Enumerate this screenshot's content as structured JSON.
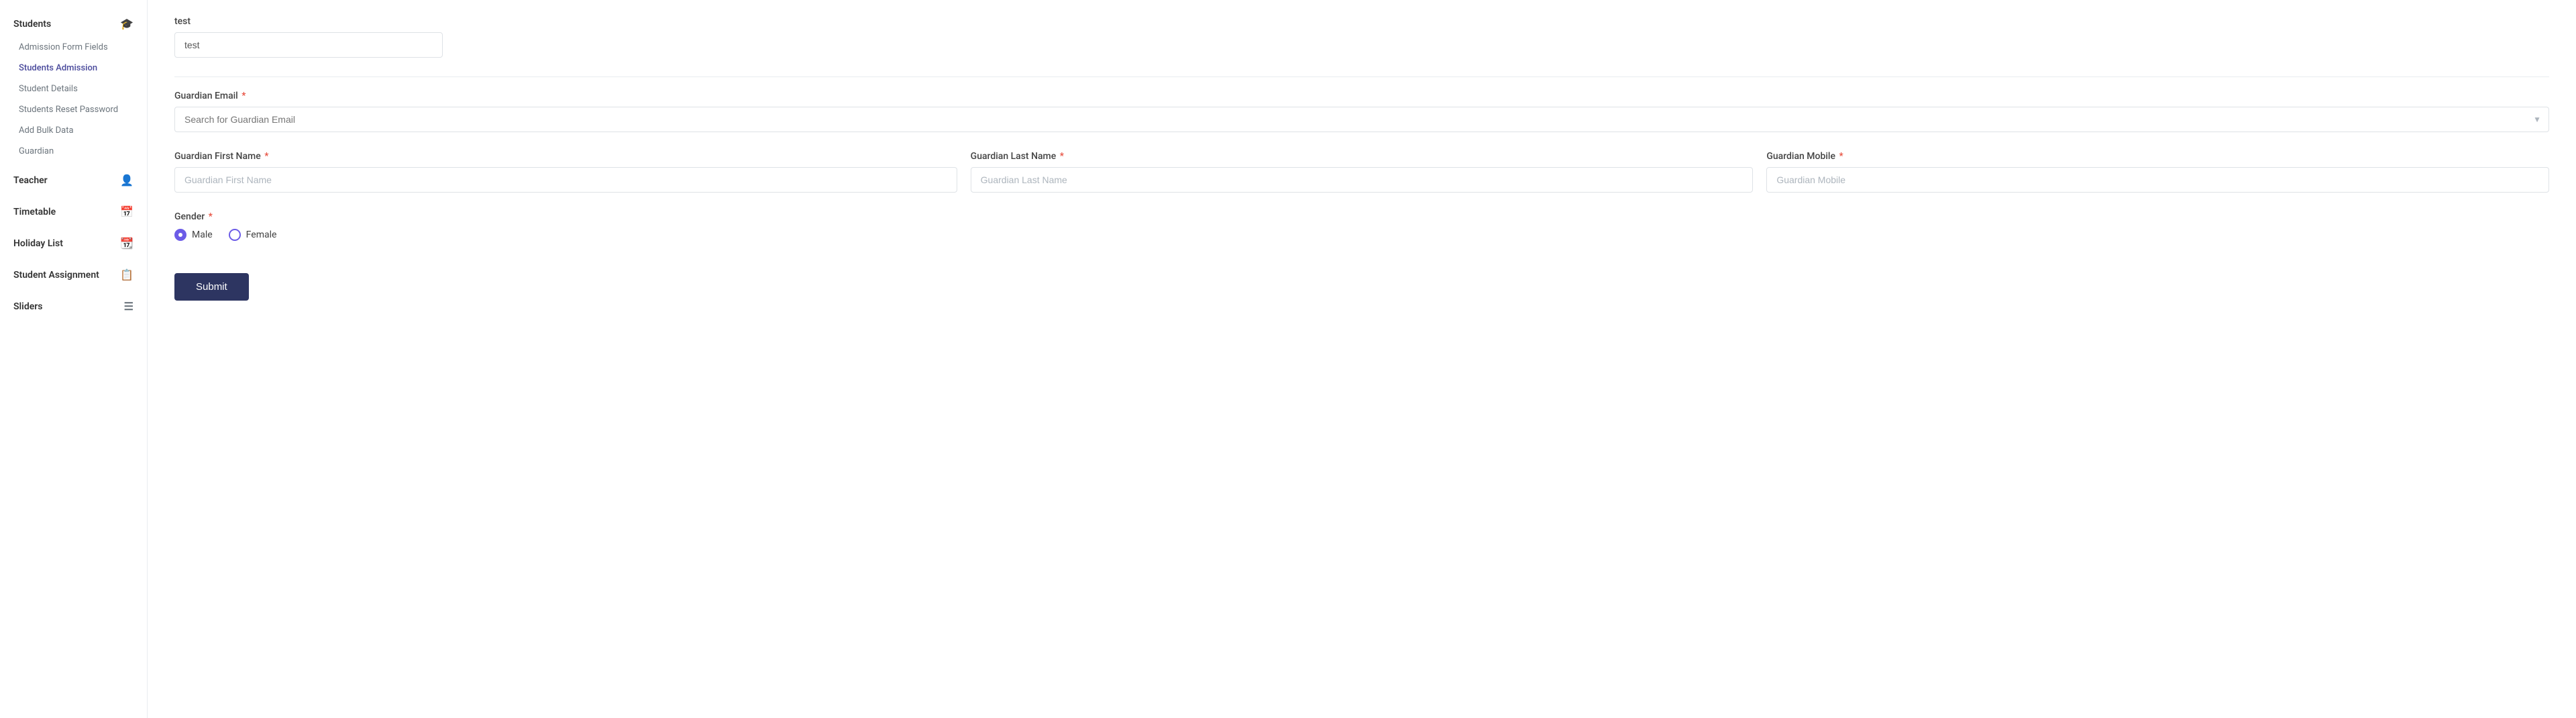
{
  "sidebar": {
    "sections": [
      {
        "id": "students",
        "label": "Students",
        "icon": "🎓",
        "items": [
          {
            "id": "admission-form-fields",
            "label": "Admission Form Fields",
            "active": false
          },
          {
            "id": "students-admission",
            "label": "Students Admission",
            "active": true
          },
          {
            "id": "student-details",
            "label": "Student Details",
            "active": false
          },
          {
            "id": "students-reset-password",
            "label": "Students Reset Password",
            "active": false
          },
          {
            "id": "add-bulk-data",
            "label": "Add Bulk Data",
            "active": false
          },
          {
            "id": "guardian",
            "label": "Guardian",
            "active": false
          }
        ]
      },
      {
        "id": "teacher",
        "label": "Teacher",
        "icon": "👤",
        "items": []
      },
      {
        "id": "timetable",
        "label": "Timetable",
        "icon": "📅",
        "items": []
      },
      {
        "id": "holiday-list",
        "label": "Holiday List",
        "icon": "📆",
        "items": []
      },
      {
        "id": "student-assignment",
        "label": "Student Assignment",
        "icon": "📋",
        "items": []
      },
      {
        "id": "sliders",
        "label": "Sliders",
        "icon": "☰",
        "items": []
      }
    ]
  },
  "form": {
    "test_field_label": "test",
    "test_field_value": "test",
    "guardian_email_label": "Guardian Email",
    "guardian_email_placeholder": "Search for Guardian Email",
    "guardian_first_name_label": "Guardian First Name",
    "guardian_first_name_placeholder": "Guardian First Name",
    "guardian_last_name_label": "Guardian Last Name",
    "guardian_last_name_placeholder": "Guardian Last Name",
    "guardian_mobile_label": "Guardian Mobile",
    "guardian_mobile_placeholder": "Guardian Mobile",
    "gender_label": "Gender",
    "gender_male_label": "Male",
    "gender_female_label": "Female",
    "submit_label": "Submit",
    "required_marker": "*"
  },
  "colors": {
    "accent": "#4a4a9c",
    "required": "#e74c3c",
    "submit_bg": "#2d3561",
    "radio_color": "#6c5ce7"
  }
}
